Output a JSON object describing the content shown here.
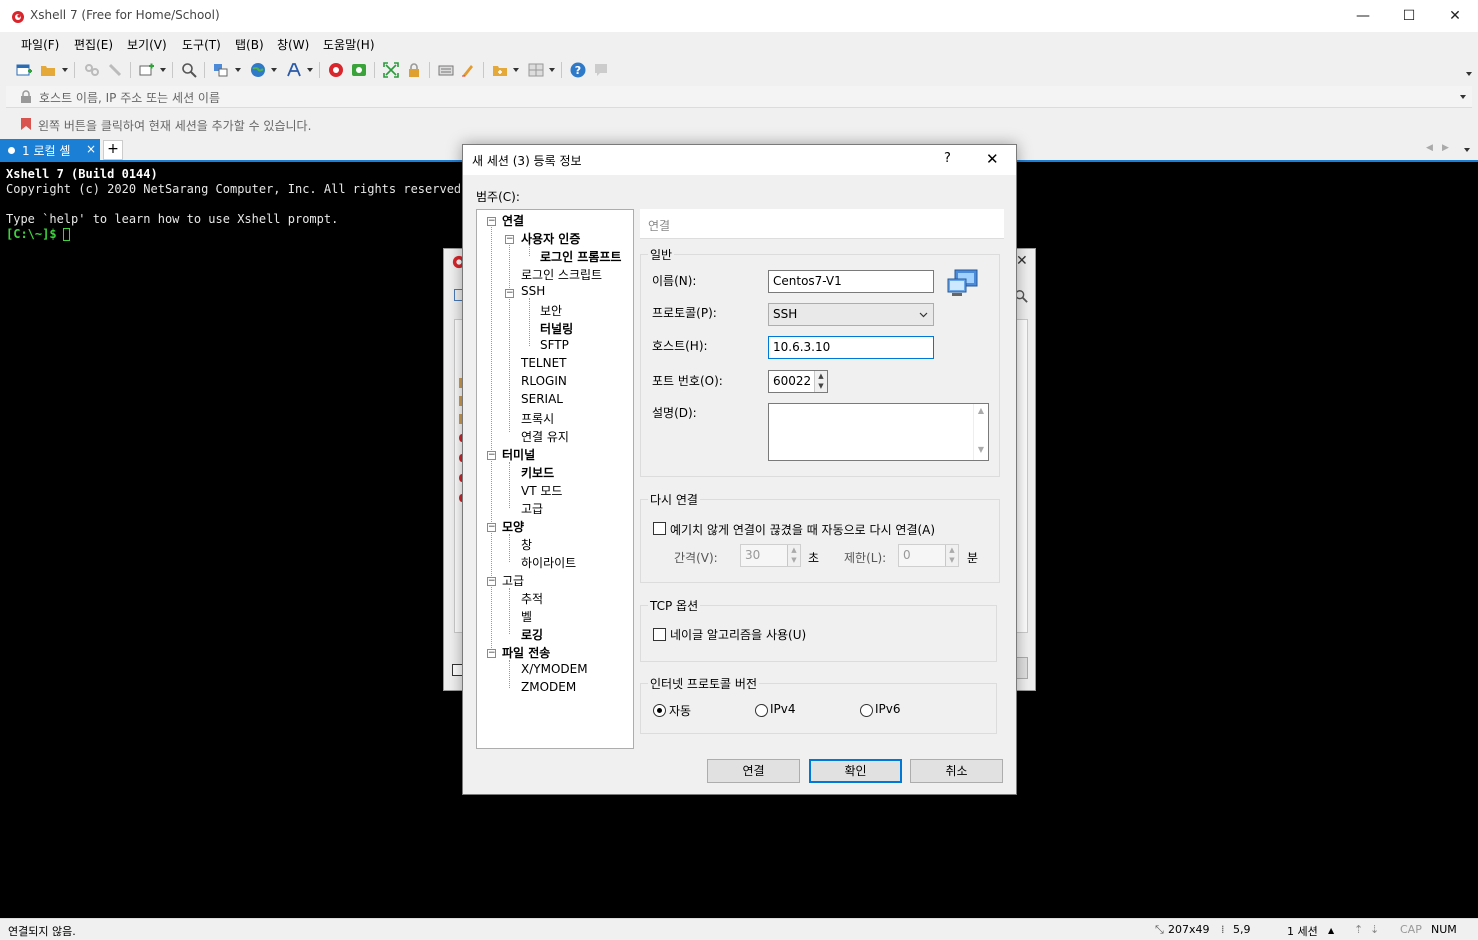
{
  "window": {
    "title": "Xshell 7 (Free for Home/School)",
    "minimize": "—",
    "maximize": "☐",
    "close": "✕"
  },
  "menu": [
    "파일(F)",
    "편집(E)",
    "보기(V)",
    "도구(T)",
    "탭(B)",
    "창(W)",
    "도움말(H)"
  ],
  "address_placeholder": "호스트 이름, IP 주소 또는 세션 이름",
  "hint": "왼쪽 버튼을 클릭하여 현재 세션을 추가할 수 있습니다.",
  "tab": {
    "label": "1 로컬 셸",
    "close": "×",
    "add": "+"
  },
  "terminal": {
    "lines": [
      "Xshell 7 (Build 0144)",
      "Copyright (c) 2020 NetSarang Computer, Inc. All rights reserved.",
      "",
      "Type `help' to learn how to use Xshell prompt."
    ],
    "prompt": "[C:\\~]$ "
  },
  "status": {
    "left": "연결되지 않음.",
    "size": "207x49",
    "pos": "5,9",
    "sessions": "1 세션",
    "cap": "CAP",
    "num": "NUM"
  },
  "dialog": {
    "title": "새 세션 (3) 등록 정보",
    "help": "?",
    "close": "✕",
    "category_label": "범주(C):",
    "tree": [
      {
        "label": "연결",
        "bold": true
      },
      {
        "label": "사용자 인증",
        "bold": true
      },
      {
        "label": "로그인 프롬프트",
        "bold": true
      },
      {
        "label": "로그인 스크립트",
        "bold": false
      },
      {
        "label": "SSH",
        "bold": false
      },
      {
        "label": "보안",
        "bold": false
      },
      {
        "label": "터널링",
        "bold": true
      },
      {
        "label": "SFTP",
        "bold": false
      },
      {
        "label": "TELNET",
        "bold": false
      },
      {
        "label": "RLOGIN",
        "bold": false
      },
      {
        "label": "SERIAL",
        "bold": false
      },
      {
        "label": "프록시",
        "bold": false
      },
      {
        "label": "연결 유지",
        "bold": false
      },
      {
        "label": "터미널",
        "bold": true
      },
      {
        "label": "키보드",
        "bold": true
      },
      {
        "label": "VT 모드",
        "bold": false
      },
      {
        "label": "고급",
        "bold": false
      },
      {
        "label": "모양",
        "bold": true
      },
      {
        "label": "창",
        "bold": false
      },
      {
        "label": "하이라이트",
        "bold": false
      },
      {
        "label": "고급",
        "bold": false
      },
      {
        "label": "추적",
        "bold": false
      },
      {
        "label": "벨",
        "bold": false
      },
      {
        "label": "로깅",
        "bold": true
      },
      {
        "label": "파일 전송",
        "bold": true
      },
      {
        "label": "X/YMODEM",
        "bold": false
      },
      {
        "label": "ZMODEM",
        "bold": false
      }
    ],
    "panel_header": "연결",
    "general": {
      "group": "일반",
      "name_label": "이름(N):",
      "name_value": "Centos7-V1",
      "protocol_label": "프로토콜(P):",
      "protocol_value": "SSH",
      "host_label": "호스트(H):",
      "host_value": "10.6.3.10",
      "port_label": "포트 번호(O):",
      "port_value": "60022",
      "desc_label": "설명(D):",
      "desc_value": ""
    },
    "reconnect": {
      "group": "다시 연결",
      "checkbox": "예기치 않게 연결이 끊겼을 때 자동으로 다시 연결(A)",
      "interval_label": "간격(V):",
      "interval_value": "30",
      "interval_unit": "초",
      "limit_label": "제한(L):",
      "limit_value": "0",
      "limit_unit": "분"
    },
    "tcp": {
      "group": "TCP 옵션",
      "checkbox": "네이글 알고리즘을 사용(U)"
    },
    "ipver": {
      "group": "인터넷 프로토콜 버전",
      "auto": "자동",
      "ipv4": "IPv4",
      "ipv6": "IPv6",
      "selected": "자동"
    },
    "buttons": {
      "connect": "연결",
      "ok": "확인",
      "cancel": "취소"
    }
  },
  "colors": {
    "accent": "#1c7fd6",
    "terminal_bg": "#000000",
    "prompt_green": "#3cd33c"
  }
}
